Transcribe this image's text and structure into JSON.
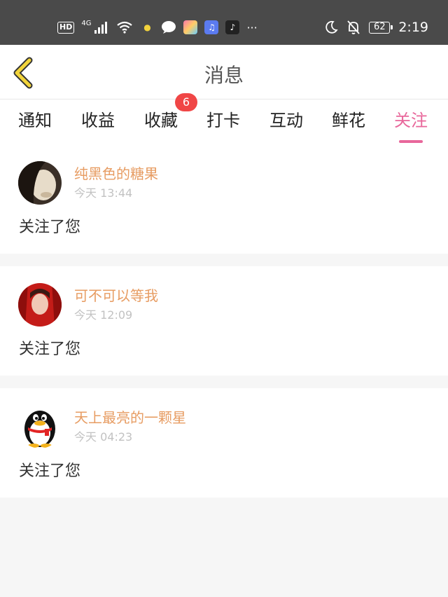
{
  "statusbar": {
    "hd": "HD",
    "network": "4G",
    "more": "···",
    "battery": "62",
    "clock": "2:19",
    "icons": [
      "signal-icon",
      "wifi-icon",
      "bulb-icon",
      "chat-icon",
      "gallery-icon",
      "music-icon",
      "tiktok-icon",
      "moon-icon",
      "bell-off-icon",
      "battery-icon"
    ]
  },
  "header": {
    "title": "消息",
    "back_icon": "chevron-left-icon",
    "accent": "#e8c200"
  },
  "tabs": {
    "items": [
      {
        "label": "通知"
      },
      {
        "label": "收益"
      },
      {
        "label": "收藏"
      },
      {
        "label": "打卡"
      },
      {
        "label": "互动"
      },
      {
        "label": "鲜花"
      },
      {
        "label": "关注"
      }
    ],
    "active_index": 6,
    "badge": "6",
    "active_color": "#e8679b"
  },
  "messages": [
    {
      "name": "纯黑色的糖果",
      "time": "今天 13:44",
      "text": "关注了您"
    },
    {
      "name": "可不可以等我",
      "time": "今天 12:09",
      "text": "关注了您"
    },
    {
      "name": "天上最亮的一颗星",
      "time": "今天 04:23",
      "text": "关注了您"
    }
  ],
  "colors": {
    "name": "#e79c62",
    "time": "#c2c2c2",
    "badge": "#f04646"
  }
}
